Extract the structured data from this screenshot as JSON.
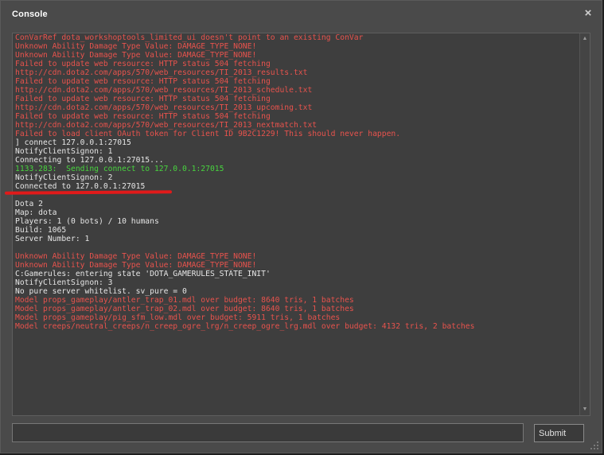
{
  "window": {
    "title": "Console",
    "close_icon": "×"
  },
  "log": {
    "lines": [
      {
        "text": "ConVarRef dota_workshoptools_limited_ui doesn't point to an existing ConVar",
        "color": "red"
      },
      {
        "text": "Unknown Ability Damage Type Value: DAMAGE_TYPE_NONE!",
        "color": "red"
      },
      {
        "text": "Unknown Ability Damage Type Value: DAMAGE_TYPE_NONE!",
        "color": "red"
      },
      {
        "text": "Failed to update web resource: HTTP status 504 fetching",
        "color": "red"
      },
      {
        "text": "http://cdn.dota2.com/apps/570/web_resources/TI_2013_results.txt",
        "color": "red"
      },
      {
        "text": "Failed to update web resource: HTTP status 504 fetching",
        "color": "red"
      },
      {
        "text": "http://cdn.dota2.com/apps/570/web_resources/TI_2013_schedule.txt",
        "color": "red"
      },
      {
        "text": "Failed to update web resource: HTTP status 504 fetching",
        "color": "red"
      },
      {
        "text": "http://cdn.dota2.com/apps/570/web_resources/TI_2013_upcoming.txt",
        "color": "red"
      },
      {
        "text": "Failed to update web resource: HTTP status 504 fetching",
        "color": "red"
      },
      {
        "text": "http://cdn.dota2.com/apps/570/web_resources/TI_2013_nextmatch.txt",
        "color": "red"
      },
      {
        "text": "Failed to load client OAuth token for Client ID 9B2C1229! This should never happen.",
        "color": "red"
      },
      {
        "text": "] connect 127.0.0.1:27015",
        "color": "white"
      },
      {
        "text": "NotifyClientSignon: 1",
        "color": "white"
      },
      {
        "text": "Connecting to 127.0.0.1:27015...",
        "color": "white"
      },
      {
        "text": "1133.283:  Sending connect to 127.0.0.1:27015",
        "color": "green"
      },
      {
        "text": "NotifyClientSignon: 2",
        "color": "white"
      },
      {
        "text": "Connected to 127.0.0.1:27015",
        "color": "white"
      },
      {
        "text": "",
        "color": "white"
      },
      {
        "text": "Dota 2",
        "color": "white"
      },
      {
        "text": "Map: dota",
        "color": "white"
      },
      {
        "text": "Players: 1 (0 bots) / 10 humans",
        "color": "white"
      },
      {
        "text": "Build: 1065",
        "color": "white"
      },
      {
        "text": "Server Number: 1",
        "color": "white"
      },
      {
        "text": "",
        "color": "white"
      },
      {
        "text": "Unknown Ability Damage Type Value: DAMAGE_TYPE_NONE!",
        "color": "red"
      },
      {
        "text": "Unknown Ability Damage Type Value: DAMAGE_TYPE_NONE!",
        "color": "red"
      },
      {
        "text": "C:Gamerules: entering state 'DOTA_GAMERULES_STATE_INIT'",
        "color": "white"
      },
      {
        "text": "NotifyClientSignon: 3",
        "color": "white"
      },
      {
        "text": "No pure server whitelist. sv_pure = 0",
        "color": "white"
      },
      {
        "text": "Model props_gameplay/antler_trap_01.mdl over budget: 8640 tris, 1 batches",
        "color": "red"
      },
      {
        "text": "Model props_gameplay/antler_trap_02.mdl over budget: 8640 tris, 1 batches",
        "color": "red"
      },
      {
        "text": "Model props_gameplay/pig_sfm_low.mdl over budget: 5911 tris, 1 batches",
        "color": "red"
      },
      {
        "text": "Model creeps/neutral_creeps/n_creep_ogre_lrg/n_creep_ogre_lrg.mdl over budget: 4132 tris, 2 batches",
        "color": "red"
      }
    ]
  },
  "scrollbar": {
    "up_icon": "▲",
    "down_icon": "▼"
  },
  "command": {
    "value": "",
    "placeholder": ""
  },
  "submit_label": "Submit",
  "colors": {
    "error": "#e8534d",
    "success": "#48d43e",
    "text": "#e6e6e6",
    "annotation": "#e11a1a"
  }
}
